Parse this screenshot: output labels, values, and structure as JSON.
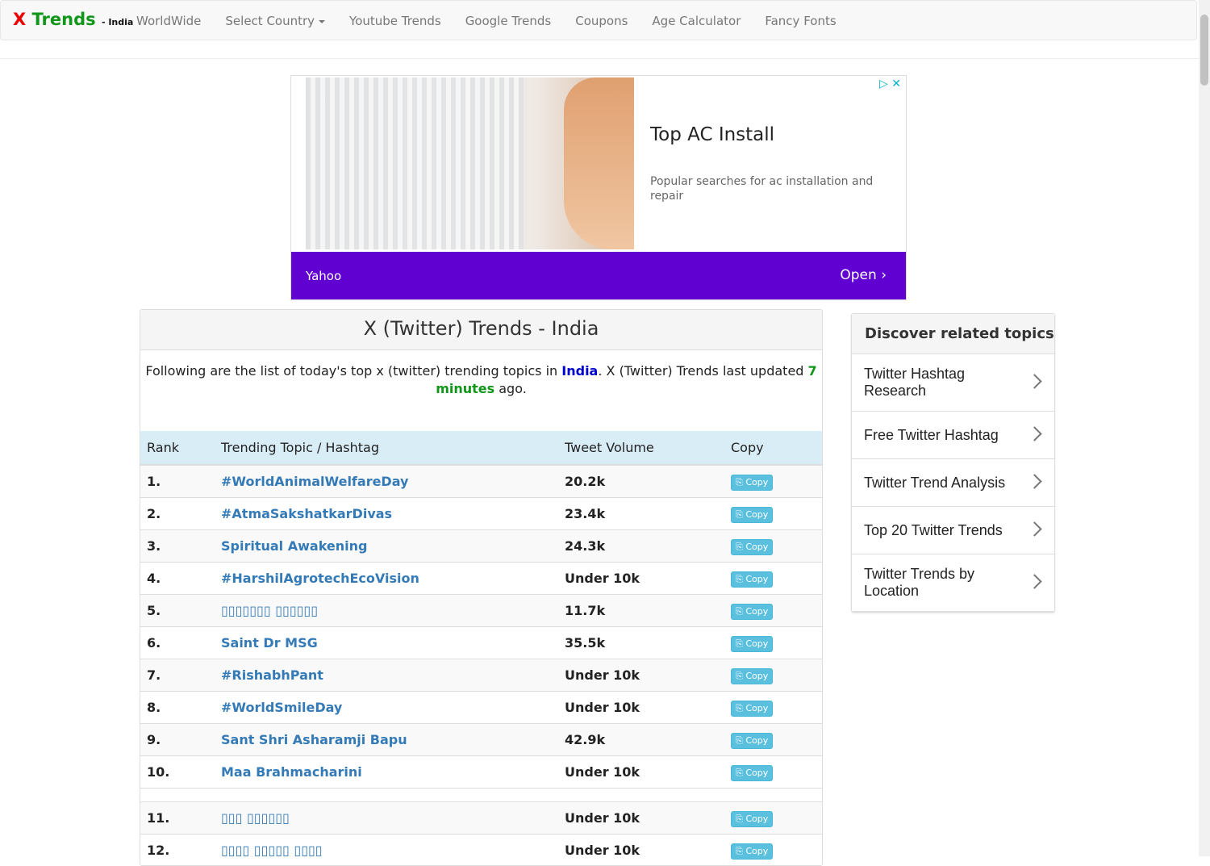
{
  "nav": {
    "brand_x": "X",
    "brand_trends": " Trends",
    "brand_country": "- India",
    "items": [
      "WorldWide",
      "Select Country",
      "Youtube Trends",
      "Google Trends",
      "Coupons",
      "Age Calculator",
      "Fancy Fonts"
    ]
  },
  "ad": {
    "title": "Top AC Install",
    "description": "Popular searches for ac installation and repair",
    "brand": "Yahoo",
    "cta": "Open",
    "icons": "▷ ✕"
  },
  "main": {
    "heading": "X (Twitter) Trends - India",
    "intro_pre": "Following are the list of today's top x (twitter) trending topics in ",
    "intro_country": "India",
    "intro_mid": ". X (Twitter) Trends last updated ",
    "intro_updated": "7 minutes",
    "intro_post": " ago.",
    "columns": [
      "Rank",
      "Trending Topic / Hashtag",
      "Tweet Volume",
      "Copy"
    ],
    "copy_label": "Copy",
    "rows": [
      {
        "rank": "1.",
        "topic": "#WorldAnimalWelfareDay",
        "volume": "20.2k"
      },
      {
        "rank": "2.",
        "topic": "#AtmaSakshatkarDivas",
        "volume": "23.4k"
      },
      {
        "rank": "3.",
        "topic": "Spiritual Awakening",
        "volume": "24.3k"
      },
      {
        "rank": "4.",
        "topic": "#HarshilAgrotechEcoVision",
        "volume": "Under 10k"
      },
      {
        "rank": "5.",
        "topic": "▯▯▯▯▯▯▯ ▯▯▯▯▯▯",
        "volume": "11.7k"
      },
      {
        "rank": "6.",
        "topic": "Saint Dr MSG",
        "volume": "35.5k"
      },
      {
        "rank": "7.",
        "topic": "#RishabhPant",
        "volume": "Under 10k"
      },
      {
        "rank": "8.",
        "topic": "#WorldSmileDay",
        "volume": "Under 10k"
      },
      {
        "rank": "9.",
        "topic": "Sant Shri Asharamji Bapu",
        "volume": "42.9k"
      },
      {
        "rank": "10.",
        "topic": "Maa Brahmacharini",
        "volume": "Under 10k"
      },
      {
        "rank": "11.",
        "topic": "▯▯▯ ▯▯▯▯▯▯",
        "volume": "Under 10k"
      },
      {
        "rank": "12.",
        "topic": "▯▯▯▯ ▯▯▯▯▯ ▯▯▯▯",
        "volume": "Under 10k"
      }
    ]
  },
  "sidebar": {
    "heading": "Discover related topics",
    "items": [
      "Twitter Hashtag Research",
      "Free Twitter Hashtag",
      "Twitter Trend Analysis",
      "Top 20 Twitter Trends",
      "Twitter Trends by Location"
    ]
  }
}
